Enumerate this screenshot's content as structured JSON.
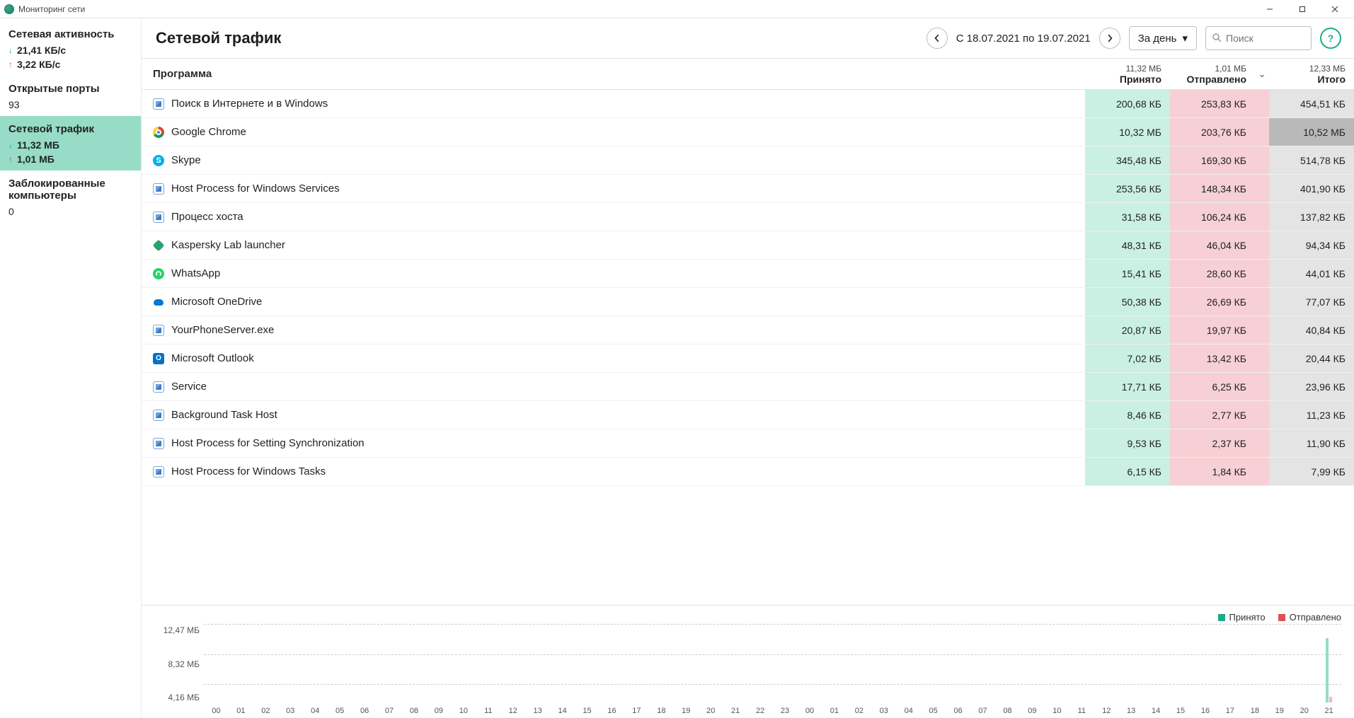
{
  "window": {
    "title": "Мониторинг сети"
  },
  "sidebar": {
    "activity": {
      "title": "Сетевая активность",
      "down": "21,41 КБ/с",
      "up": "3,22 КБ/с"
    },
    "ports": {
      "title": "Открытые порты",
      "count": "93"
    },
    "traffic": {
      "title": "Сетевой трафик",
      "down": "11,32 МБ",
      "up": "1,01 МБ"
    },
    "blocked": {
      "title": "Заблокированные компьютеры",
      "count": "0"
    }
  },
  "toolbar": {
    "title": "Сетевой трафик",
    "range": "С 18.07.2021 по 19.07.2021",
    "period": "За день",
    "search_placeholder": "Поиск"
  },
  "columns": {
    "program": "Программа",
    "received_total": "11,32 МБ",
    "received_label": "Принято",
    "sent_total": "1,01 МБ",
    "sent_label": "Отправлено",
    "total_total": "12,33 МБ",
    "total_label": "Итого"
  },
  "rows": [
    {
      "icon": "win",
      "name": "Поиск в Интернете и в Windows",
      "recv": "200,68 КБ",
      "sent": "253,83 КБ",
      "total": "454,51 КБ",
      "hl": false
    },
    {
      "icon": "chrome",
      "name": "Google Chrome",
      "recv": "10,32 МБ",
      "sent": "203,76 КБ",
      "total": "10,52 МБ",
      "hl": true
    },
    {
      "icon": "skype",
      "name": "Skype",
      "recv": "345,48 КБ",
      "sent": "169,30 КБ",
      "total": "514,78 КБ",
      "hl": false
    },
    {
      "icon": "win",
      "name": "Host Process for Windows Services",
      "recv": "253,56 КБ",
      "sent": "148,34 КБ",
      "total": "401,90 КБ",
      "hl": false
    },
    {
      "icon": "win",
      "name": "Процесс хоста",
      "recv": "31,58 КБ",
      "sent": "106,24 КБ",
      "total": "137,82 КБ",
      "hl": false
    },
    {
      "icon": "kasp",
      "name": "Kaspersky Lab launcher",
      "recv": "48,31 КБ",
      "sent": "46,04 КБ",
      "total": "94,34 КБ",
      "hl": false
    },
    {
      "icon": "wa",
      "name": "WhatsApp",
      "recv": "15,41 КБ",
      "sent": "28,60 КБ",
      "total": "44,01 КБ",
      "hl": false
    },
    {
      "icon": "od",
      "name": "Microsoft OneDrive",
      "recv": "50,38 КБ",
      "sent": "26,69 КБ",
      "total": "77,07 КБ",
      "hl": false
    },
    {
      "icon": "win",
      "name": "YourPhoneServer.exe",
      "recv": "20,87 КБ",
      "sent": "19,97 КБ",
      "total": "40,84 КБ",
      "hl": false
    },
    {
      "icon": "ol",
      "name": "Microsoft Outlook",
      "recv": "7,02 КБ",
      "sent": "13,42 КБ",
      "total": "20,44 КБ",
      "hl": false
    },
    {
      "icon": "win",
      "name": "Service",
      "recv": "17,71 КБ",
      "sent": "6,25 КБ",
      "total": "23,96 КБ",
      "hl": false
    },
    {
      "icon": "win",
      "name": "Background Task Host",
      "recv": "8,46 КБ",
      "sent": "2,77 КБ",
      "total": "11,23 КБ",
      "hl": false
    },
    {
      "icon": "win",
      "name": "Host Process for Setting Synchronization",
      "recv": "9,53 КБ",
      "sent": "2,37 КБ",
      "total": "11,90 КБ",
      "hl": false
    },
    {
      "icon": "win",
      "name": "Host Process for Windows Tasks",
      "recv": "6,15 КБ",
      "sent": "1,84 КБ",
      "total": "7,99 КБ",
      "hl": false
    }
  ],
  "legend": {
    "recv": "Принято",
    "sent": "Отправлено"
  },
  "chart_data": {
    "type": "bar",
    "ylabel_unit": "МБ",
    "ylim": [
      0,
      12.47
    ],
    "y_ticks": [
      "12,47 МБ",
      "8,32 МБ",
      "4,16 МБ"
    ],
    "categories": [
      "00",
      "01",
      "02",
      "03",
      "04",
      "05",
      "06",
      "07",
      "08",
      "09",
      "10",
      "11",
      "12",
      "13",
      "14",
      "15",
      "16",
      "17",
      "18",
      "19",
      "20",
      "21",
      "22",
      "23",
      "00",
      "01",
      "02",
      "03",
      "04",
      "05",
      "06",
      "07",
      "08",
      "09",
      "10",
      "11",
      "12",
      "13",
      "14",
      "15",
      "16",
      "17",
      "18",
      "19",
      "20",
      "21"
    ],
    "series": [
      {
        "name": "Принято",
        "color": "#1eaa88",
        "values": [
          0,
          0,
          0,
          0,
          0,
          0,
          0,
          0,
          0,
          0,
          0,
          0,
          0,
          0,
          0,
          0,
          0,
          0,
          0,
          0,
          0,
          0,
          0,
          0,
          0,
          0,
          0,
          0,
          0,
          0,
          0,
          0,
          0,
          0,
          0,
          0,
          0,
          0,
          0,
          0,
          0,
          0,
          0,
          0,
          0,
          11.3
        ]
      },
      {
        "name": "Отправлено",
        "color": "#e05050",
        "values": [
          0,
          0,
          0,
          0,
          0,
          0,
          0,
          0,
          0,
          0,
          0,
          0,
          0,
          0,
          0,
          0,
          0,
          0,
          0,
          0,
          0,
          0,
          0,
          0,
          0,
          0,
          0,
          0,
          0,
          0,
          0,
          0,
          0,
          0,
          0,
          0,
          0,
          0,
          0,
          0,
          0,
          0,
          0,
          0,
          0,
          1.0
        ]
      }
    ]
  }
}
